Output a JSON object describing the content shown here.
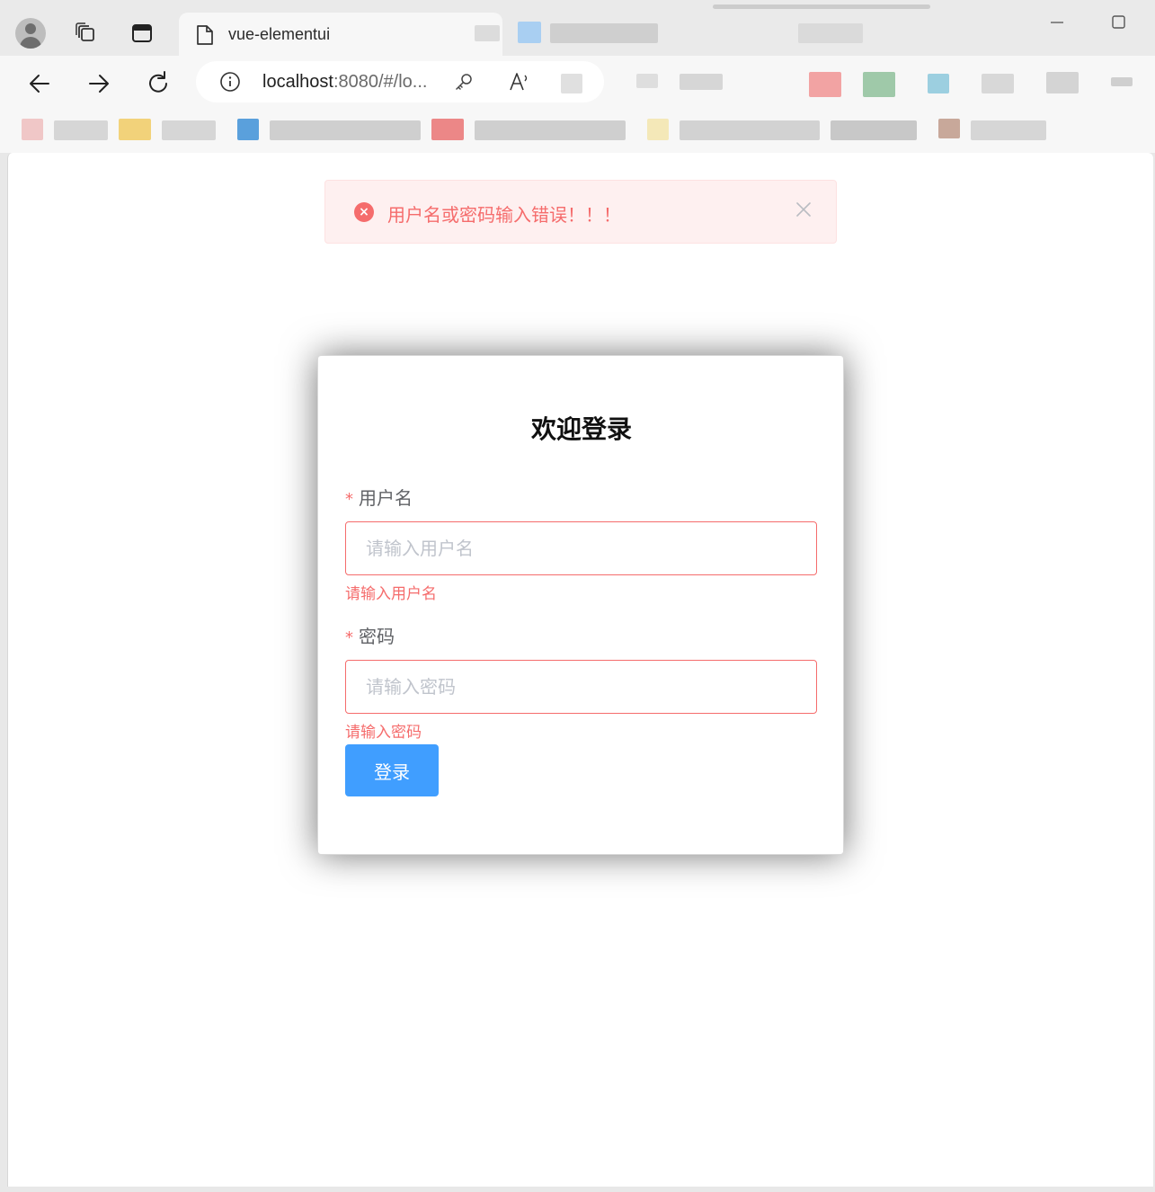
{
  "browser": {
    "tab_title": "vue-elementui",
    "url_host": "localhost",
    "url_rest": ":8080/#/lo..."
  },
  "alert": {
    "message": "用户名或密码输入错误！！！",
    "icon": "error-circle-icon",
    "close_icon": "close-icon",
    "type": "error"
  },
  "login": {
    "title": "欢迎登录",
    "username": {
      "required_mark": "*",
      "label": "用户名",
      "placeholder": "请输入用户名",
      "value": "",
      "error": "请输入用户名"
    },
    "password": {
      "required_mark": "*",
      "label": "密码",
      "placeholder": "请输入密码",
      "value": "",
      "error": "请输入密码"
    },
    "submit_label": "登录"
  },
  "colors": {
    "primary": "#409eff",
    "danger": "#f56c6c",
    "alert_bg": "#fef0f0"
  }
}
